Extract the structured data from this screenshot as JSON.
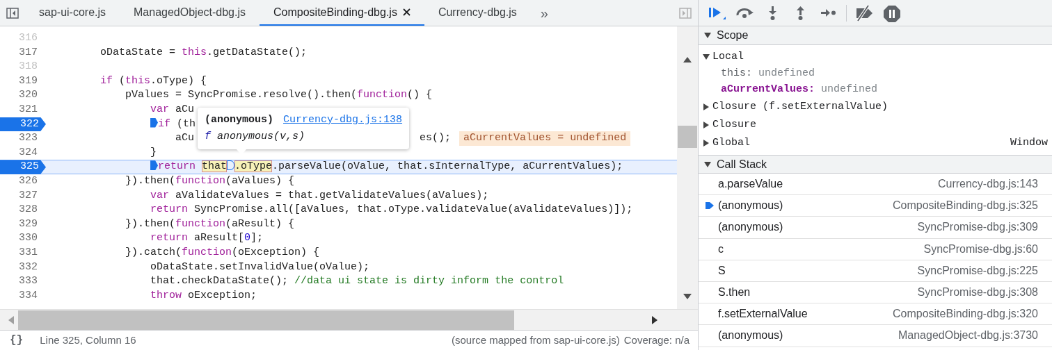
{
  "tabs": [
    {
      "label": "sap-ui-core.js",
      "selected": false,
      "closable": false
    },
    {
      "label": "ManagedObject-dbg.js",
      "selected": false,
      "closable": false
    },
    {
      "label": "CompositeBinding-dbg.js",
      "selected": true,
      "closable": true
    },
    {
      "label": "Currency-dbg.js",
      "selected": false,
      "closable": false
    }
  ],
  "tabs_overflow": "»",
  "code_lines": [
    {
      "number": "316",
      "breakpoint": false,
      "current": false
    },
    {
      "number": "317",
      "breakpoint": false,
      "current": false,
      "segments": [
        {
          "kind": "plain",
          "text": "        oDataState = "
        },
        {
          "kind": "keyword",
          "text": "this"
        },
        {
          "kind": "plain",
          "text": ".getDataState();"
        }
      ]
    },
    {
      "number": "318",
      "breakpoint": false,
      "current": false
    },
    {
      "number": "319",
      "breakpoint": false,
      "current": false,
      "segments": [
        {
          "kind": "keyword",
          "text": "        if"
        },
        {
          "kind": "plain",
          "text": " ("
        },
        {
          "kind": "keyword",
          "text": "this"
        },
        {
          "kind": "plain",
          "text": ".oType) {"
        }
      ]
    },
    {
      "number": "320",
      "breakpoint": false,
      "current": false,
      "segments": [
        {
          "kind": "plain",
          "text": "            pValues = SyncPromise.resolve().then("
        },
        {
          "kind": "keyword",
          "text": "function"
        },
        {
          "kind": "plain",
          "text": "() {"
        }
      ]
    },
    {
      "number": "321",
      "breakpoint": false,
      "current": false,
      "segments": [
        {
          "kind": "keyword",
          "text": "                var"
        },
        {
          "kind": "plain",
          "text": " aCu"
        }
      ]
    },
    {
      "number": "322",
      "breakpoint": true,
      "current": false,
      "segments": [
        {
          "kind": "keyword",
          "text": "                if",
          "marker_active": true
        },
        {
          "kind": "plain",
          "text": " (th"
        }
      ]
    },
    {
      "number": "323",
      "breakpoint": false,
      "current": false,
      "segments": [
        {
          "kind": "plain",
          "text": "                    aCu"
        },
        {
          "kind": "gap"
        },
        {
          "kind": "plain",
          "text": "es();"
        }
      ],
      "inline_value": "aCurrentValues = undefined"
    },
    {
      "number": "324",
      "breakpoint": false,
      "current": false,
      "segments": [
        {
          "kind": "plain",
          "text": "                }"
        }
      ]
    },
    {
      "number": "325",
      "breakpoint": true,
      "current": true,
      "segments": [
        {
          "kind": "keyword",
          "text": "                return",
          "marker_active": true
        },
        {
          "kind": "hover",
          "text": " that"
        },
        {
          "kind": "hover",
          "text": ".oType",
          "marker_active": false
        },
        {
          "kind": "plain",
          "text": ".parseValue(oValue, that.sInternalType, aCurrentValues);"
        }
      ]
    },
    {
      "number": "326",
      "breakpoint": false,
      "current": false,
      "segments": [
        {
          "kind": "plain",
          "text": "            }).then("
        },
        {
          "kind": "keyword",
          "text": "function"
        },
        {
          "kind": "plain",
          "text": "(aValues) {"
        }
      ]
    },
    {
      "number": "327",
      "breakpoint": false,
      "current": false,
      "segments": [
        {
          "kind": "keyword",
          "text": "                var"
        },
        {
          "kind": "plain",
          "text": " aValidateValues = that.getValidateValues(aValues);"
        }
      ]
    },
    {
      "number": "328",
      "breakpoint": false,
      "current": false,
      "segments": [
        {
          "kind": "keyword",
          "text": "                return"
        },
        {
          "kind": "plain",
          "text": " SyncPromise.all([aValues, that.oType.validateValue(aValidateValues)]);"
        }
      ]
    },
    {
      "number": "329",
      "breakpoint": false,
      "current": false,
      "segments": [
        {
          "kind": "plain",
          "text": "            }).then("
        },
        {
          "kind": "keyword",
          "text": "function"
        },
        {
          "kind": "plain",
          "text": "(aResult) {"
        }
      ]
    },
    {
      "number": "330",
      "breakpoint": false,
      "current": false,
      "segments": [
        {
          "kind": "keyword",
          "text": "                return"
        },
        {
          "kind": "plain",
          "text": " aResult["
        },
        {
          "kind": "number",
          "text": "0"
        },
        {
          "kind": "plain",
          "text": "];"
        }
      ]
    },
    {
      "number": "331",
      "breakpoint": false,
      "current": false,
      "segments": [
        {
          "kind": "plain",
          "text": "            }).catch("
        },
        {
          "kind": "keyword",
          "text": "function"
        },
        {
          "kind": "plain",
          "text": "(oException) {"
        }
      ]
    },
    {
      "number": "332",
      "breakpoint": false,
      "current": false,
      "segments": [
        {
          "kind": "plain",
          "text": "                oDataState.setInvalidValue(oValue);"
        }
      ]
    },
    {
      "number": "333",
      "breakpoint": false,
      "current": false,
      "segments": [
        {
          "kind": "plain",
          "text": "                that.checkDataState(); "
        },
        {
          "kind": "comment",
          "text": "//data ui state is dirty inform the control"
        }
      ]
    },
    {
      "number": "334",
      "breakpoint": false,
      "current": false,
      "segments": [
        {
          "kind": "keyword",
          "text": "                throw"
        },
        {
          "kind": "plain",
          "text": " oException;"
        }
      ]
    }
  ],
  "tooltip": {
    "title": "(anonymous)",
    "link": "Currency-dbg.js:138",
    "symbol": "f",
    "signature": "anonymous(v,s)"
  },
  "status_bar": {
    "format_button": "{}",
    "position": "Line 325, Column 16",
    "source": "(source mapped from sap-ui-core.js)",
    "coverage": "Coverage: n/a"
  },
  "debug_toolbar": [
    {
      "kind": "resume",
      "active": true
    },
    {
      "kind": "step-over",
      "active": false
    },
    {
      "kind": "step-into",
      "active": false
    },
    {
      "kind": "step-out",
      "active": false
    },
    {
      "kind": "step",
      "active": false
    },
    {
      "kind": "divider"
    },
    {
      "kind": "deactivate",
      "active": false
    },
    {
      "kind": "pause-exceptions",
      "active": false
    }
  ],
  "scope": {
    "title": "Scope",
    "expanded": true,
    "items": [
      {
        "label": "Local",
        "expanded": true,
        "children": [
          {
            "name": "this:",
            "value": "undefined",
            "highlighted": false
          },
          {
            "name": "aCurrentValues:",
            "value": "undefined",
            "highlighted": true
          }
        ]
      },
      {
        "label": "Closure (f.setExternalValue)",
        "expanded": false
      },
      {
        "label": "Closure",
        "expanded": false
      },
      {
        "label": "Global",
        "expanded": false,
        "value": "Window"
      }
    ]
  },
  "call_stack": {
    "title": "Call Stack",
    "expanded": true,
    "frames": [
      {
        "name": "a.parseValue",
        "location": "Currency-dbg.js:143",
        "selected": false
      },
      {
        "name": "(anonymous)",
        "location": "CompositeBinding-dbg.js:325",
        "selected": true
      },
      {
        "name": "(anonymous)",
        "location": "SyncPromise-dbg.js:309",
        "selected": false
      },
      {
        "name": "c",
        "location": "SyncPromise-dbg.js:60",
        "selected": false
      },
      {
        "name": "S",
        "location": "SyncPromise-dbg.js:225",
        "selected": false
      },
      {
        "name": "S.then",
        "location": "SyncPromise-dbg.js:308",
        "selected": false
      },
      {
        "name": "f.setExternalValue",
        "location": "CompositeBinding-dbg.js:320",
        "selected": false
      },
      {
        "name": "(anonymous)",
        "location": "ManagedObject-dbg.js:3730",
        "selected": false
      }
    ]
  }
}
